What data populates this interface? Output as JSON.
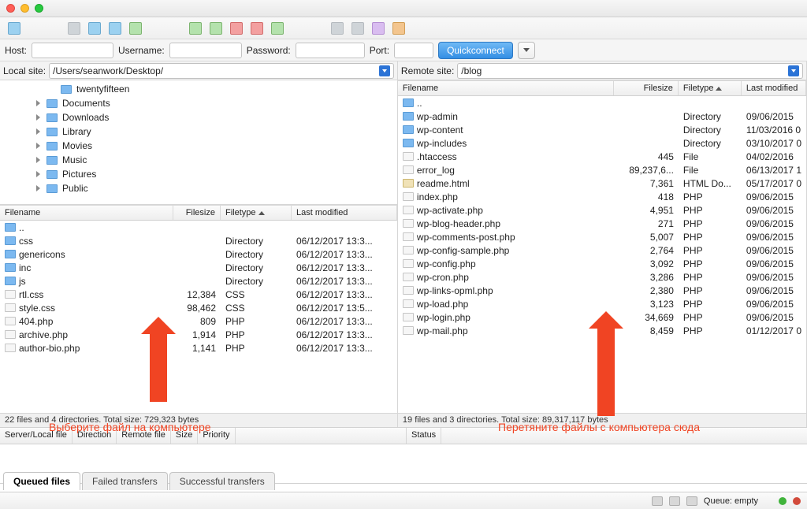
{
  "qc": {
    "host_label": "Host:",
    "user_label": "Username:",
    "pass_label": "Password:",
    "port_label": "Port:",
    "button": "Quickconnect"
  },
  "local": {
    "label": "Local site:",
    "path": "/Users/seanwork/Desktop/",
    "tree": [
      "twentyfifteen",
      "Documents",
      "Downloads",
      "Library",
      "Movies",
      "Music",
      "Pictures",
      "Public"
    ],
    "head": {
      "fn": "Filename",
      "sz": "Filesize",
      "ft": "Filetype",
      "lm": "Last modified"
    },
    "rows": [
      {
        "n": "..",
        "t": "",
        "s": "",
        "m": "",
        "ico": "fld"
      },
      {
        "n": "css",
        "t": "Directory",
        "s": "",
        "m": "06/12/2017 13:3...",
        "ico": "fld"
      },
      {
        "n": "genericons",
        "t": "Directory",
        "s": "",
        "m": "06/12/2017 13:3...",
        "ico": "fld"
      },
      {
        "n": "inc",
        "t": "Directory",
        "s": "",
        "m": "06/12/2017 13:3...",
        "ico": "fld"
      },
      {
        "n": "js",
        "t": "Directory",
        "s": "",
        "m": "06/12/2017 13:3...",
        "ico": "fld"
      },
      {
        "n": "rtl.css",
        "t": "CSS",
        "s": "12,384",
        "m": "06/12/2017 13:3...",
        "ico": "doc"
      },
      {
        "n": "style.css",
        "t": "CSS",
        "s": "98,462",
        "m": "06/12/2017 13:5...",
        "ico": "doc"
      },
      {
        "n": "404.php",
        "t": "PHP",
        "s": "809",
        "m": "06/12/2017 13:3...",
        "ico": "doc"
      },
      {
        "n": "archive.php",
        "t": "PHP",
        "s": "1,914",
        "m": "06/12/2017 13:3...",
        "ico": "doc"
      },
      {
        "n": "author-bio.php",
        "t": "PHP",
        "s": "1,141",
        "m": "06/12/2017 13:3...",
        "ico": "doc"
      }
    ],
    "status": "22 files and 4 directories. Total size: 729,323 bytes"
  },
  "remote": {
    "label": "Remote site:",
    "path": "/blog",
    "head": {
      "fn": "Filename",
      "sz": "Filesize",
      "ft": "Filetype",
      "lm": "Last modified"
    },
    "rows": [
      {
        "n": "..",
        "t": "",
        "s": "",
        "m": "",
        "ico": "fld"
      },
      {
        "n": "wp-admin",
        "t": "Directory",
        "s": "",
        "m": "09/06/2015",
        "ico": "fld"
      },
      {
        "n": "wp-content",
        "t": "Directory",
        "s": "",
        "m": "11/03/2016 0",
        "ico": "fld"
      },
      {
        "n": "wp-includes",
        "t": "Directory",
        "s": "",
        "m": "03/10/2017 0",
        "ico": "fld"
      },
      {
        "n": ".htaccess",
        "t": "File",
        "s": "445",
        "m": "04/02/2016",
        "ico": "doc"
      },
      {
        "n": "error_log",
        "t": "File",
        "s": "89,237,6...",
        "m": "06/13/2017 1",
        "ico": "doc"
      },
      {
        "n": "readme.html",
        "t": "HTML Do...",
        "s": "7,361",
        "m": "05/17/2017 0",
        "ico": "html"
      },
      {
        "n": "index.php",
        "t": "PHP",
        "s": "418",
        "m": "09/06/2015",
        "ico": "doc"
      },
      {
        "n": "wp-activate.php",
        "t": "PHP",
        "s": "4,951",
        "m": "09/06/2015",
        "ico": "doc"
      },
      {
        "n": "wp-blog-header.php",
        "t": "PHP",
        "s": "271",
        "m": "09/06/2015",
        "ico": "doc"
      },
      {
        "n": "wp-comments-post.php",
        "t": "PHP",
        "s": "5,007",
        "m": "09/06/2015",
        "ico": "doc"
      },
      {
        "n": "wp-config-sample.php",
        "t": "PHP",
        "s": "2,764",
        "m": "09/06/2015",
        "ico": "doc"
      },
      {
        "n": "wp-config.php",
        "t": "PHP",
        "s": "3,092",
        "m": "09/06/2015",
        "ico": "doc"
      },
      {
        "n": "wp-cron.php",
        "t": "PHP",
        "s": "3,286",
        "m": "09/06/2015",
        "ico": "doc"
      },
      {
        "n": "wp-links-opml.php",
        "t": "PHP",
        "s": "2,380",
        "m": "09/06/2015",
        "ico": "doc"
      },
      {
        "n": "wp-load.php",
        "t": "PHP",
        "s": "3,123",
        "m": "09/06/2015",
        "ico": "doc"
      },
      {
        "n": "wp-login.php",
        "t": "PHP",
        "s": "34,669",
        "m": "09/06/2015",
        "ico": "doc"
      },
      {
        "n": "wp-mail.php",
        "t": "PHP",
        "s": "8,459",
        "m": "01/12/2017 0",
        "ico": "doc"
      }
    ],
    "status": "19 files and 3 directories. Total size: 89,317,117 bytes"
  },
  "queue": {
    "left": [
      "Server/Local file",
      "Direction",
      "Remote file",
      "Size",
      "Priority"
    ],
    "right": [
      "Status"
    ]
  },
  "annot": {
    "a1": "Выберите файл на компьютере",
    "a2": "Перетяните файлы с компьютера сюда"
  },
  "tabs": [
    "Queued files",
    "Failed transfers",
    "Successful transfers"
  ],
  "footer": {
    "queue": "Queue: empty"
  }
}
